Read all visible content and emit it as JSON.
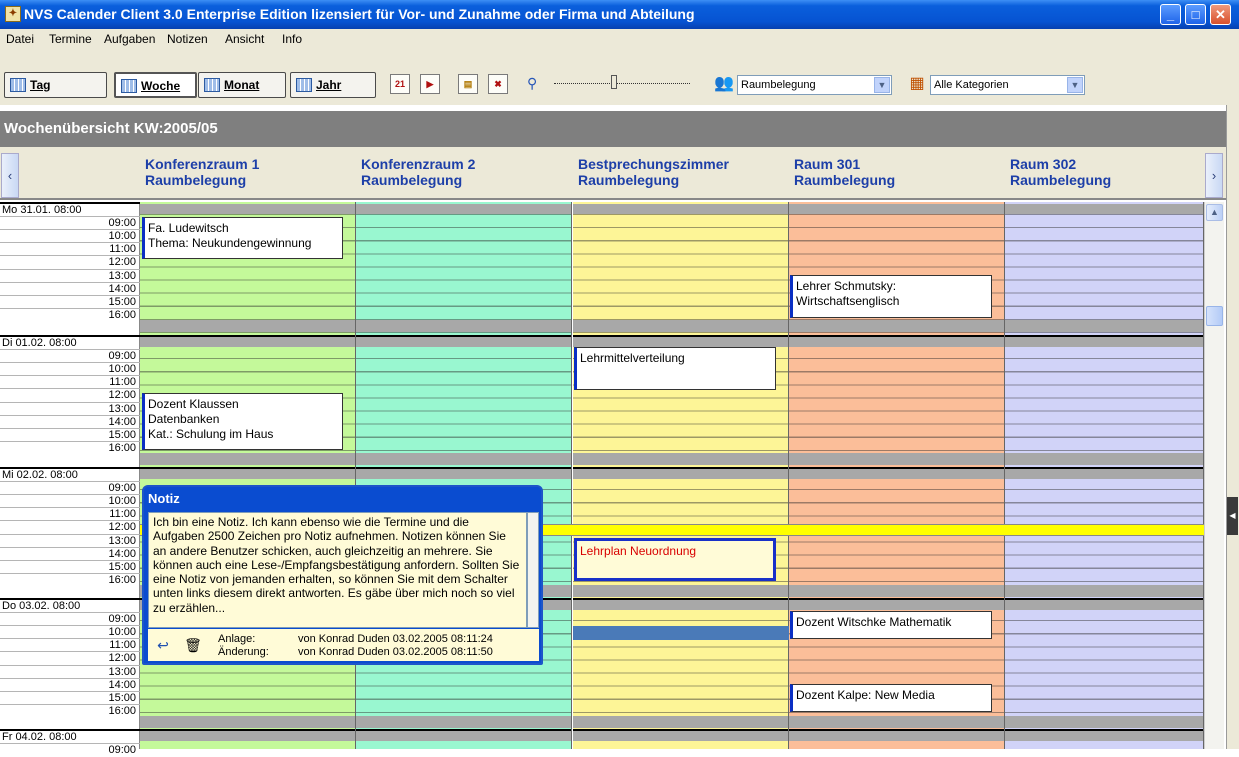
{
  "window": {
    "title": "NVS Calender Client 3.0 Enterprise Edition    lizensiert für Vor- und Zunahme oder Firma und Abteilung"
  },
  "menu": [
    "Datei",
    "Termine",
    "Aufgaben",
    "Notizen",
    "Ansicht",
    "Info"
  ],
  "views": {
    "tag": "Tag",
    "woche": "Woche",
    "monat": "Monat",
    "jahr": "Jahr"
  },
  "toolbar": {
    "icons": [
      "calendar-21-icon",
      "calendar-next-icon",
      "folder-icon",
      "delete-icon"
    ]
  },
  "filters": {
    "resource": "Raumbelegung",
    "category": "Alle Kategorien"
  },
  "overview": {
    "title": "Wochenübersicht   KW:2005/05"
  },
  "columns": [
    {
      "name": "Konferenzraum 1",
      "sub": "Raumbelegung",
      "color": "#c4f99a"
    },
    {
      "name": "Konferenzraum 2",
      "sub": "Raumbelegung",
      "color": "#99f7d0"
    },
    {
      "name": "Bestprechungszimmer",
      "sub": "Raumbelegung",
      "color": "#fdf597"
    },
    {
      "name": "Raum 301",
      "sub": "Raumbelegung",
      "color": "#fbbe99"
    },
    {
      "name": "Raum 302",
      "sub": "Raumbelegung",
      "color": "#d1d3f8"
    }
  ],
  "days": [
    {
      "label": "Mo 31.01.   08:00"
    },
    {
      "label": "Di 01.02.   08:00"
    },
    {
      "label": "Mi 02.02.   08:00"
    },
    {
      "label": "Do 03.02.   08:00"
    },
    {
      "label": "Fr 04.02.   08:00"
    }
  ],
  "hours": [
    "09:00",
    "10:00",
    "11:00",
    "12:00",
    "13:00",
    "14:00",
    "15:00",
    "16:00"
  ],
  "appointments": [
    {
      "text": "Fa. Ludewitsch\nThema: Neukundengewinnung"
    },
    {
      "text": "Lehrer Schmutsky:\nWirtschaftsenglisch"
    },
    {
      "text": "Lehrmittelverteilung"
    },
    {
      "text": "Dozent Klaussen\nDatenbanken\nKat.: Schulung im Haus"
    },
    {
      "text": "Lehrplan Neuordnung"
    },
    {
      "text": "Dozent Witschke Mathematik"
    },
    {
      "text": "Dozent Kalpe: New Media"
    }
  ],
  "note": {
    "title": "Notiz",
    "body": "Ich bin eine Notiz. Ich kann ebenso wie die Termine und die Aufgaben 2500 Zeichen pro Notiz aufnehmen. Notizen können Sie an andere Benutzer schicken, auch gleichzeitig an mehrere. Sie können auch eine Lese-/Empfangsbestätigung anfordern. Sollten Sie eine Notiz von jemanden erhalten, so können Sie mit dem Schalter unten links diesem direkt antworten. Es gäbe über mich noch so viel zu erzählen...",
    "created_label": "Anlage:",
    "created_value": "von Konrad Duden 03.02.2005 08:11:24",
    "changed_label": "Änderung:",
    "changed_value": "von Konrad Duden 03.02.2005 08:11:50"
  }
}
